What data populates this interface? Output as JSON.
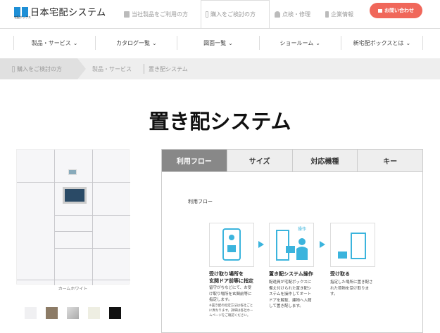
{
  "header": {
    "logo": "日本宅配システム",
    "logo_sub": "宅配ボックス",
    "tabs": [
      {
        "label": "当社製品をご利用の方",
        "icon": "mailbox-icon"
      },
      {
        "label": "購入をご検討の方",
        "icon": "door-icon",
        "active": true
      },
      {
        "label": "点検・修理",
        "icon": "helmet-icon"
      },
      {
        "label": "企業情報",
        "icon": "wrench-icon"
      }
    ],
    "contact": "お問い合わせ"
  },
  "nav": {
    "items": [
      "製品・サービス",
      "カタログ一覧",
      "図面一覧",
      "ショールーム",
      "新宅配ボックスとは"
    ]
  },
  "breadcrumb": [
    "購入をご検討の方",
    "製品・サービス",
    "置き配システム"
  ],
  "page_title": "置き配システム",
  "product": {
    "caption": "カームホワイト",
    "swatches": [
      "#f0f0f2",
      "#8c7b66",
      "#bcbcbc",
      "#eeeee2",
      "#111111"
    ]
  },
  "tabs": [
    {
      "label": "利用フロー",
      "active": true
    },
    {
      "label": "サイズ"
    },
    {
      "label": "対応機種"
    },
    {
      "label": "キー"
    }
  ],
  "flow": {
    "heading": "利用フロー",
    "accent": "#3bb4dd",
    "steps": [
      {
        "title": "受け取り場所を\n玄関ドア前等に指定",
        "desc": "留守がちなどにて、お受け取り場所を玄関前等に指定します。",
        "note": "※置き配の指定方法は各社ごとに異なります。詳細は各社ホームページをご確認ください。",
        "op_label": ""
      },
      {
        "title": "置き配システム操作",
        "desc": "配達員が宅配ボックスに備え付けられた置き配システムを操作してオートドアを解錠、建物へ入館して置き配します。",
        "op_label": "操作"
      },
      {
        "title": "受け取る",
        "desc": "指定した場所に置き配された荷物を受け取ります。"
      }
    ]
  }
}
